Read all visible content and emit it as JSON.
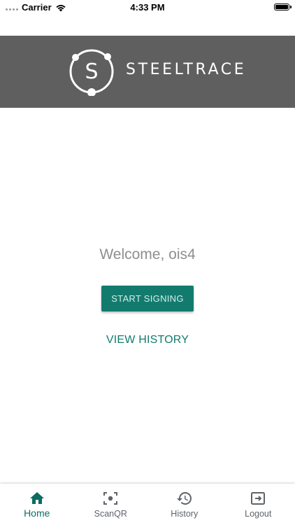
{
  "status_bar": {
    "carrier": "Carrier",
    "time": "4:33 PM"
  },
  "header": {
    "logo_letter": "S",
    "brand_name": "STEELTRACE",
    "background_color": "#5f5f5f"
  },
  "main": {
    "welcome_text": "Welcome, ois4",
    "start_signing_label": "START SIGNING",
    "view_history_label": "VIEW HISTORY",
    "accent_color": "#127b6e"
  },
  "tab_bar": {
    "active_tab": "Home",
    "tabs": [
      {
        "label": "Home",
        "icon": "home-icon"
      },
      {
        "label": "ScanQR",
        "icon": "scan-qr-icon"
      },
      {
        "label": "History",
        "icon": "history-icon"
      },
      {
        "label": "Logout",
        "icon": "logout-icon"
      }
    ]
  }
}
